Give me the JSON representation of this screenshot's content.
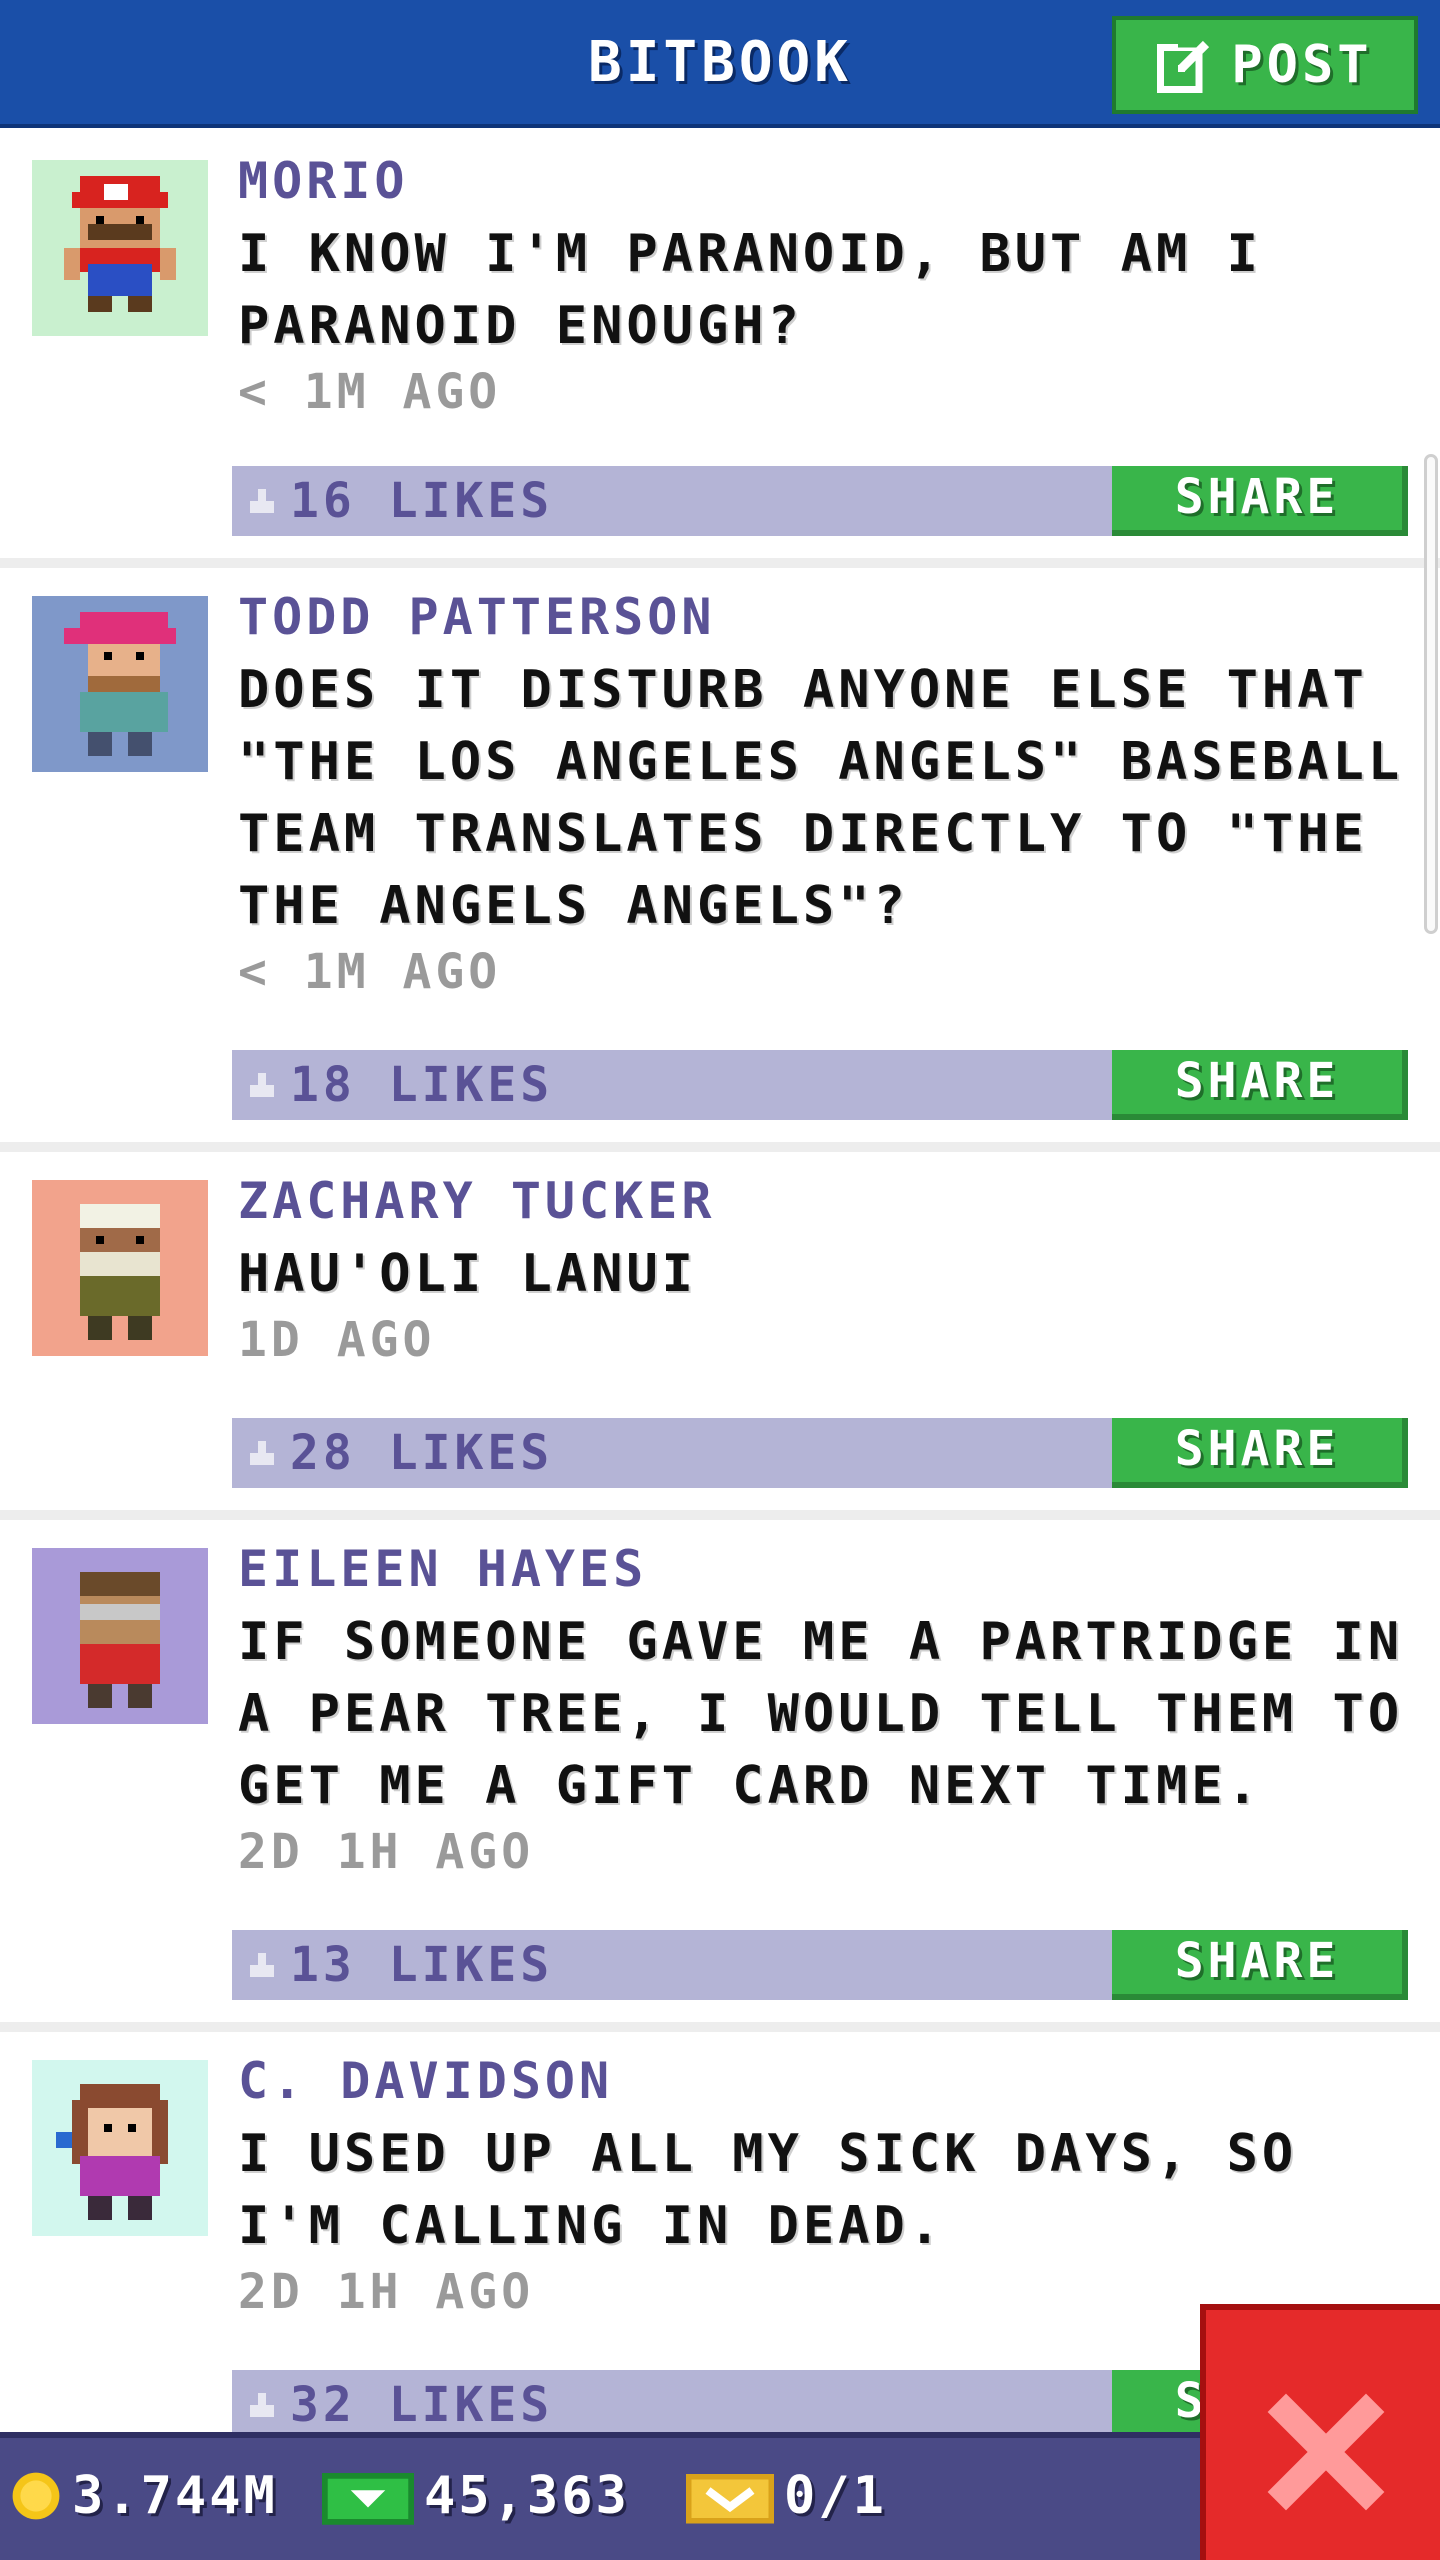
{
  "header": {
    "title": "BITBOOK",
    "post_label": "POST"
  },
  "posts": [
    {
      "author": "MORIO",
      "text": "I KNOW I'M PARANOID, BUT AM I PARANOID ENOUGH?",
      "time": "< 1M AGO",
      "likes": "16 LIKES",
      "share": "SHARE",
      "avatar_bg": "#c9f0cf"
    },
    {
      "author": "TODD PATTERSON",
      "text": "DOES IT DISTURB ANYONE ELSE THAT \"THE LOS ANGELES ANGELS\" BASEBALL TEAM TRANSLATES DIRECTLY TO \"THE THE ANGELS ANGELS\"?",
      "time": "< 1M AGO",
      "likes": "18 LIKES",
      "share": "SHARE",
      "avatar_bg": "#7f98c9"
    },
    {
      "author": "ZACHARY TUCKER",
      "text": "HAU'OLI LANUI",
      "time": "1D AGO",
      "likes": "28 LIKES",
      "share": "SHARE",
      "avatar_bg": "#f2a38c"
    },
    {
      "author": "EILEEN HAYES",
      "text": "IF SOMEONE GAVE ME A PARTRIDGE IN A PEAR TREE, I WOULD TELL THEM TO GET ME A GIFT CARD NEXT TIME.",
      "time": "2D 1H AGO",
      "likes": "13 LIKES",
      "share": "SHARE",
      "avatar_bg": "#a99ad8"
    },
    {
      "author": "C. DAVIDSON",
      "text": "I USED UP ALL MY SICK DAYS, SO I'M CALLING IN DEAD.",
      "time": "2D 1H AGO",
      "likes": "32 LIKES",
      "share": "SHARE",
      "avatar_bg": "#d2f7ee"
    }
  ],
  "bottom": {
    "coins": "3.744M",
    "cash": "45,363",
    "tickets": "0/1"
  },
  "colors": {
    "header_bg": "#1a4fa8",
    "accent_green": "#39b54a",
    "likes_bar": "#b4b4d6",
    "bottom_bar": "#4a4a86",
    "close_red": "#e52a2a"
  },
  "icons": [
    "edit-icon",
    "like-icon",
    "coin-icon",
    "cash-icon",
    "ticket-icon",
    "close-icon"
  ]
}
